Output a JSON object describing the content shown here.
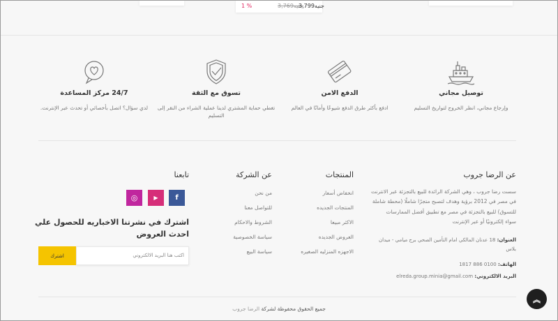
{
  "product_strip": {
    "discount": "1 %",
    "new_price": "3,799جنيه",
    "old_price": "3,769جنيه"
  },
  "features": [
    {
      "icon": "ship-icon",
      "title": "توصيل مجاني",
      "desc": "وإرجاع مجاني، انظر الخروج لتواريخ التسليم"
    },
    {
      "icon": "credit-card-icon",
      "title": "الدفع الامن",
      "desc": "ادفع بأكثر طرق الدفع شيوعًا وأمانًا في العالم"
    },
    {
      "icon": "shield-check-icon",
      "title": "تسوق مع الثقة",
      "desc": "تغطي حماية المشتري لدينا عملية الشراء من النقر إلى التسليم"
    },
    {
      "icon": "support-chat-icon",
      "title": "24/7 مركز المساعدة",
      "desc": "لدي سؤال؟ اتصل بأخصائي أو تحدث عبر الإنترنت."
    }
  ],
  "about": {
    "title": "عن الرضا جروب",
    "text_lines": [
      "سست رضا جروب ، وهي الشركة الرائدة للبيع بالتجزئة عبر الانترنت",
      "في مصر في 2012 برؤية وهدف لتصبح متجرًا شاملًا (محطة شاملة",
      "للتسوق) للبيع بالتجزئة في مصر مع تطبيق أفضل الممارسات",
      "سواء إلكترونيًا أو عبر الإنترنت"
    ],
    "address_label": "العنوان:",
    "address_value": " 18 عدنان المالكي امام التأمين الصحي برج ميامي - ميدان",
    "address_cont": "بلاس",
    "phone_label": "الهاتف:",
    "phone_value": " 0100 886 1817",
    "email_label": "البريد الالكتروني:",
    "email_value": " elreda.group.minia@gmail.com"
  },
  "products_col": {
    "title": "المنتجات",
    "links": [
      "انخفاض أسعار",
      "المنتجات الجديده",
      "الاكثر مبيعا",
      "العروض الجديده",
      "الاجهزه المنزليه الصغيره"
    ]
  },
  "company_col": {
    "title": "عن الشركة",
    "links": [
      "من نحن",
      "للتواصل معنا",
      "الشروط والاحكام",
      "سياسة الخصوصية",
      "سياسة البيع"
    ]
  },
  "follow": {
    "title": "تابعنا",
    "social": [
      {
        "name": "facebook-icon",
        "glyph": "f",
        "color": "#3b5998"
      },
      {
        "name": "youtube-icon",
        "glyph": "▶",
        "color": "#d62e79"
      },
      {
        "name": "instagram-icon",
        "glyph": "◎",
        "color": "#c0269e"
      }
    ]
  },
  "newsletter": {
    "title_line1": "اشترك في نشرتنا الاخباريه للحصول علي",
    "title_line2": "احدث العروض",
    "placeholder": "اكتب هنا البريد الالكتروني",
    "button": "اشترك"
  },
  "copyright": {
    "text": "جميع الحقوق محفوظة لشركة ",
    "brand": "الرضا جروب"
  },
  "back_to_top": "︽"
}
